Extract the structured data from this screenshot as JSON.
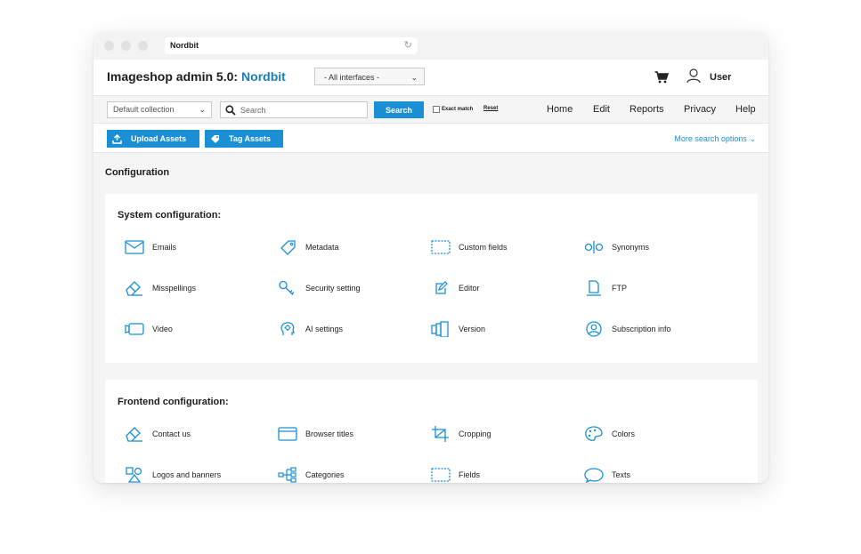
{
  "browser": {
    "url_title": "Nordbit"
  },
  "header": {
    "app_title": "Imageshop admin 5.0:",
    "brand": "Nordbit",
    "interfaces_selected": "- All interfaces -",
    "user_label": "User"
  },
  "search": {
    "collection_selected": "Default collection",
    "placeholder": "Search",
    "button_label": "Search",
    "exact_match_label": "Exact match",
    "reset_label": "Reset"
  },
  "nav": {
    "items": [
      "Home",
      "Edit",
      "Reports",
      "Privacy",
      "Help"
    ]
  },
  "actions": {
    "upload_label": "Upload Assets",
    "tag_label": "Tag Assets",
    "more_search_label": "More search options"
  },
  "page": {
    "title": "Configuration"
  },
  "system": {
    "title": "System configuration:",
    "items": [
      {
        "label": "Emails",
        "icon": "envelope-icon"
      },
      {
        "label": "Metadata",
        "icon": "tag-icon"
      },
      {
        "label": "Custom fields",
        "icon": "dashed-box-icon"
      },
      {
        "label": "Synonyms",
        "icon": "synonyms-icon"
      },
      {
        "label": "Misspellings",
        "icon": "eraser-icon"
      },
      {
        "label": "Security setting",
        "icon": "key-icon"
      },
      {
        "label": "Editor",
        "icon": "edit-icon"
      },
      {
        "label": "FTP",
        "icon": "document-icon"
      },
      {
        "label": "Video",
        "icon": "video-icon"
      },
      {
        "label": "AI settings",
        "icon": "ai-head-icon"
      },
      {
        "label": "Version",
        "icon": "version-icon"
      },
      {
        "label": "Subscription info",
        "icon": "user-circle-icon"
      }
    ]
  },
  "frontend": {
    "title": "Frontend configuration:",
    "items": [
      {
        "label": "Contact us",
        "icon": "pencil-icon"
      },
      {
        "label": "Browser titles",
        "icon": "browser-window-icon"
      },
      {
        "label": "Cropping",
        "icon": "crop-icon"
      },
      {
        "label": "Colors",
        "icon": "palette-icon"
      },
      {
        "label": "Logos and banners",
        "icon": "shapes-icon"
      },
      {
        "label": "Categories",
        "icon": "hierarchy-icon"
      },
      {
        "label": "Fields",
        "icon": "dashed-box-icon"
      },
      {
        "label": "Texts",
        "icon": "speech-bubble-icon"
      }
    ]
  },
  "colors": {
    "accent": "#1a8fd6",
    "brand": "#1a7dbf",
    "icon_stroke": "#1a8fd6"
  }
}
